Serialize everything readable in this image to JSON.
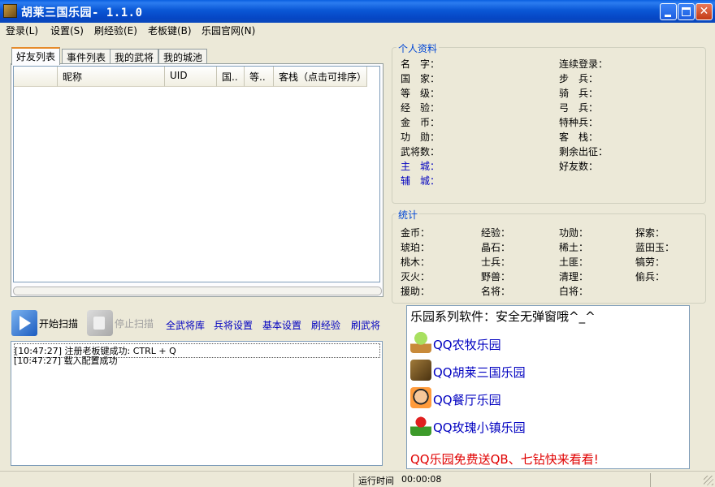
{
  "window": {
    "title": "胡莱三国乐园- 1.1.0"
  },
  "menu": [
    {
      "label": "登录(L)"
    },
    {
      "label": "设置(S)"
    },
    {
      "label": "刷经验(E)"
    },
    {
      "label": "老板键(B)"
    },
    {
      "label": "乐园官网(N)"
    }
  ],
  "tabs": [
    {
      "label": "好友列表",
      "active": true
    },
    {
      "label": "事件列表"
    },
    {
      "label": "我的武将"
    },
    {
      "label": "我的城池"
    }
  ],
  "friend_table": {
    "columns": [
      "",
      "昵称",
      "UID",
      "国..",
      "等..",
      "客栈（点击可排序）"
    ],
    "rows": []
  },
  "toolbar": {
    "start_scan": "开始扫描",
    "stop_scan": "停止扫描",
    "links": [
      "全武将库",
      "兵将设置",
      "基本设置",
      "刷经验",
      "刷武将"
    ]
  },
  "log": [
    {
      "time": "[10:47:27]",
      "text": "注册老板键成功: CTRL + Q"
    },
    {
      "time": "[10:47:27]",
      "text": "载入配置成功"
    }
  ],
  "profile": {
    "title": "个人资料",
    "left": [
      "名　字：",
      "国　家：",
      "等　级：",
      "经　验：",
      "金　币：",
      "功　勋：",
      "武将数：",
      "主　城：",
      "辅　城："
    ],
    "right": [
      "连续登录：",
      "步　兵：",
      "骑　兵：",
      "弓　兵：",
      "特种兵：",
      "客　栈：",
      "剩余出征：",
      "好友数："
    ]
  },
  "stats": {
    "title": "统计",
    "rows": [
      [
        "金币：",
        "经验：",
        "功勋：",
        "探索："
      ],
      [
        "琥珀：",
        "晶石：",
        "稀土：",
        "蓝田玉："
      ],
      [
        "桃木：",
        "士兵：",
        "土匪：",
        "犒劳："
      ],
      [
        "灭火：",
        "野兽：",
        "清理：",
        "偷兵："
      ],
      [
        "援助：",
        "名将：",
        "白将："
      ]
    ]
  },
  "ads": {
    "header": "乐园系列软件：安全无弹窗哦^_^",
    "links": [
      {
        "label": "QQ农牧乐园",
        "icon": "farm-icon"
      },
      {
        "label": "QQ胡莱三国乐园",
        "icon": "three-kingdoms-icon"
      },
      {
        "label": "QQ餐厅乐园",
        "icon": "restaurant-icon"
      },
      {
        "label": "QQ玫瑰小镇乐园",
        "icon": "rose-icon"
      }
    ],
    "footer": "QQ乐园免费送QB、七钻快来看看!"
  },
  "status": {
    "runtime_label": "运行时间",
    "runtime_value": "00:00:08"
  },
  "colors": {
    "title_bar": "#0a57d6",
    "link": "#0000c0",
    "footer_red": "#e00000",
    "group_title": "#0046d5"
  }
}
